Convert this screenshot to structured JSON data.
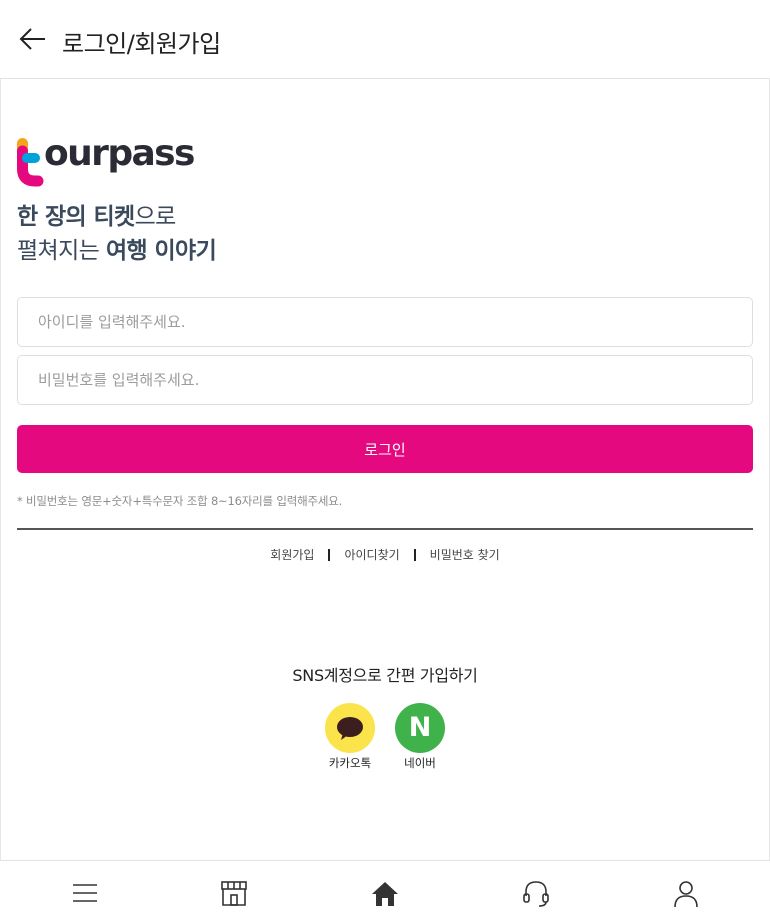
{
  "header": {
    "title": "로그인/회원가입",
    "back_icon": "arrow-left-icon"
  },
  "logo": {
    "text": "ourpass",
    "brand_colors": [
      "#f4a51c",
      "#00a3d9",
      "#e5097f"
    ]
  },
  "tagline": {
    "line1_bold": "한 장의 티켓",
    "line1_rest": "으로",
    "line2_rest": "펼쳐지는 ",
    "line2_bold": "여행 이야기"
  },
  "form": {
    "id_placeholder": "아이디를 입력해주세요.",
    "id_value": "",
    "pw_placeholder": "비밀번호를 입력해주세요.",
    "pw_value": "",
    "login_label": "로그인",
    "password_hint": "* 비밀번호는 영문+숫자+특수문자 조합 8~16자리를 입력해주세요."
  },
  "links": {
    "signup": "회원가입",
    "find_id": "아이디찾기",
    "find_pw": "비밀번호 찾기"
  },
  "sns": {
    "title": "SNS계정으로 간편 가입하기",
    "kakao_label": "카카오톡",
    "naver_label": "네이버",
    "naver_letter": "N",
    "kakao_color": "#fbe34b",
    "naver_color": "#3fb24c"
  },
  "bottom_nav": {
    "items": [
      "menu-icon",
      "store-icon",
      "home-icon",
      "headset-icon",
      "user-icon"
    ]
  },
  "colors": {
    "accent": "#e5097f",
    "text_dark": "#3a4a5c"
  }
}
